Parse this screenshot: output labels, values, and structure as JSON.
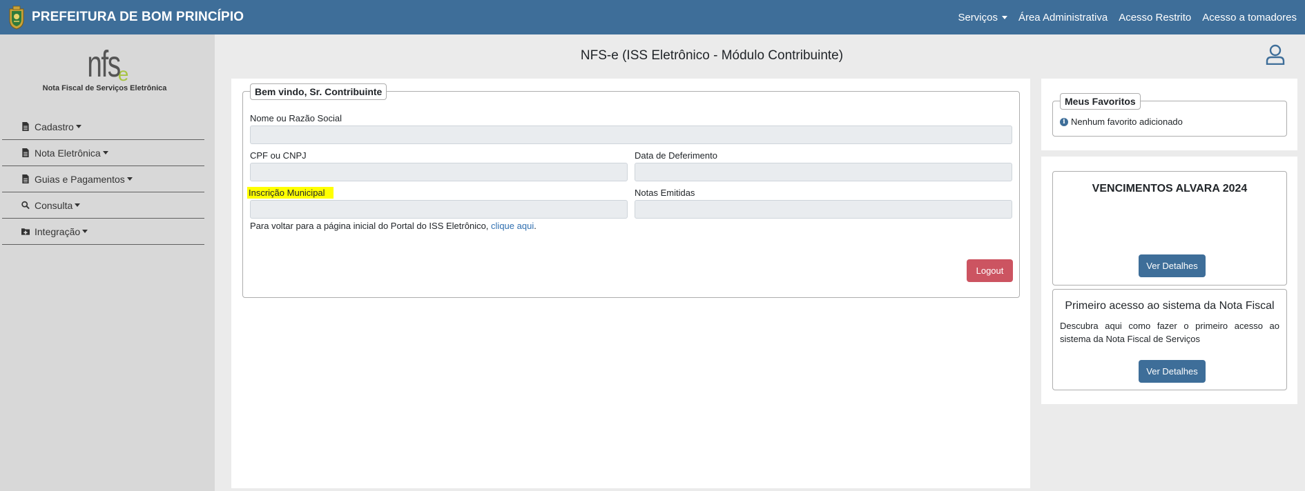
{
  "navbar": {
    "brand_title": "PREFEITURA DE BOM PRINCÍPIO",
    "links": [
      {
        "label": "Serviços",
        "dropdown": true
      },
      {
        "label": "Área Administrativa"
      },
      {
        "label": "Acesso Restrito"
      },
      {
        "label": "Acesso a tomadores"
      }
    ],
    "background_color": "#3e6e99"
  },
  "sidebar": {
    "logo_text": "nfs",
    "logo_suffix": "e",
    "logo_caption": "Nota Fiscal de Serviços Eletrônica",
    "menu": [
      {
        "label": "Cadastro",
        "icon": "document-icon"
      },
      {
        "label": "Nota Eletrônica",
        "icon": "document-icon"
      },
      {
        "label": "Guias e Pagamentos",
        "icon": "document-icon"
      },
      {
        "label": "Consulta",
        "icon": "search-icon"
      },
      {
        "label": "Integração",
        "icon": "folder-plus-icon"
      }
    ]
  },
  "header": {
    "page_title": "NFS-e (ISS Eletrônico - Módulo Contribuinte)",
    "user_icon": "user-icon"
  },
  "welcome": {
    "legend": "Bem vindo, Sr. Contribuinte",
    "fields": {
      "name_label": "Nome ou Razão Social",
      "name_value": "",
      "cpf_label": "CPF ou CNPJ",
      "cpf_value": "",
      "deferment_label": "Data de Deferimento",
      "deferment_value": "",
      "municipal_label": "Inscrição Municipal",
      "municipal_value": "",
      "notes_label": "Notas Emitidas",
      "notes_value": ""
    },
    "back_text": "Para voltar para a página inicial do Portal do ISS Eletrônico, ",
    "back_link": "clique aqui",
    "back_suffix": ".",
    "logout_label": "Logout",
    "logout_color": "#cc5461",
    "highlight_color": "#ffff00"
  },
  "favorites": {
    "legend": "Meus Favoritos",
    "empty_text": "Nenhum favorito adicionado"
  },
  "news": [
    {
      "title": "VENCIMENTOS ALVARA 2024",
      "body": "",
      "button_label": "Ver Detalhes"
    },
    {
      "title": "Primeiro acesso ao sistema da Nota Fiscal",
      "body": "Descubra aqui como fazer o primeiro acesso ao sistema da Nota Fiscal de Serviços",
      "button_label": "Ver Detalhes"
    }
  ]
}
